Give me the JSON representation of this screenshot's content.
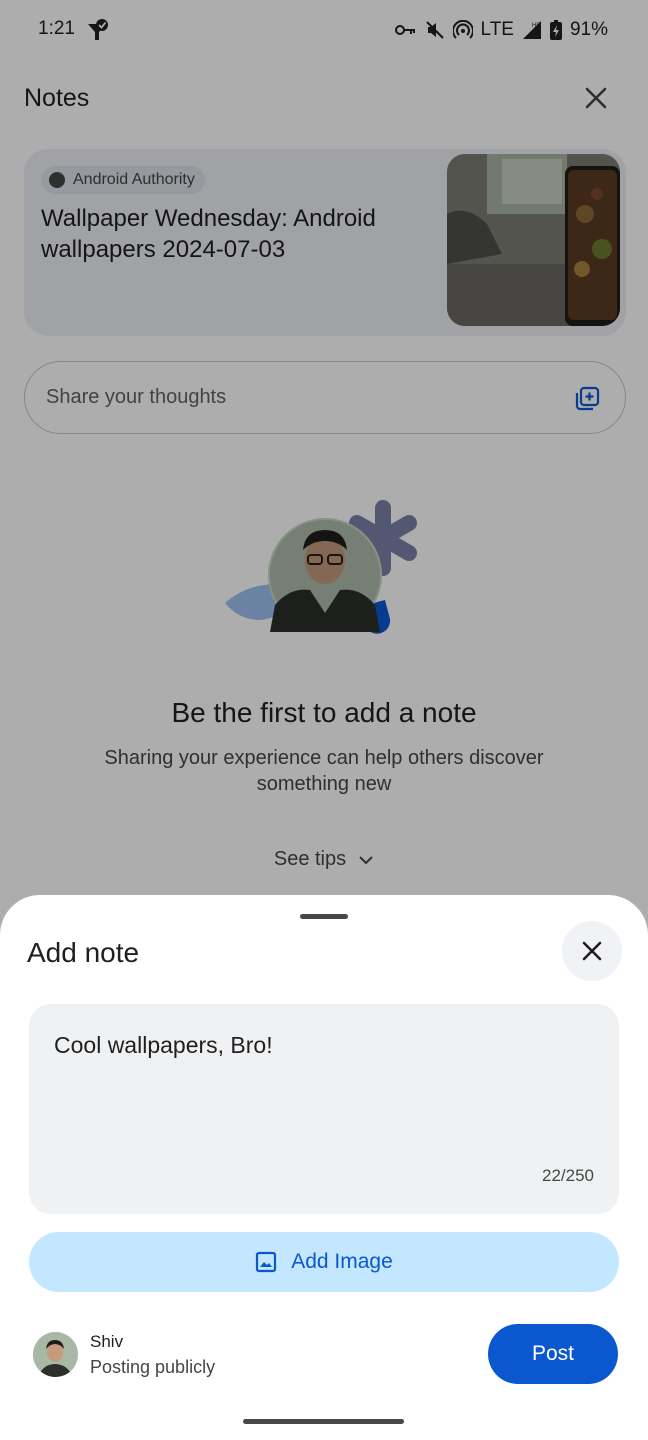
{
  "status_bar": {
    "time": "1:21",
    "network": "LTE",
    "battery": "91%"
  },
  "header": {
    "title": "Notes",
    "close_icon": "close-icon"
  },
  "article": {
    "source": "Android Authority",
    "title": "Wallpaper Wednesday: Android wallpapers 2024-07-03"
  },
  "share_field": {
    "placeholder": "Share your thoughts",
    "icon": "add-media-icon"
  },
  "empty_state": {
    "title": "Be the first to add a note",
    "subtitle": "Sharing your experience can help others discover something new",
    "see_tips": "See tips"
  },
  "sheet": {
    "title": "Add note",
    "note_text": "Cool wallpapers, Bro!",
    "char_count": "22/250",
    "add_image_label": "Add Image",
    "user_name": "Shiv",
    "posting_status": "Posting publicly",
    "post_label": "Post"
  },
  "colors": {
    "accent": "#0b57d0",
    "tonal_button": "#c2e7ff",
    "scrim": "rgba(0,0,0,0.32)"
  }
}
